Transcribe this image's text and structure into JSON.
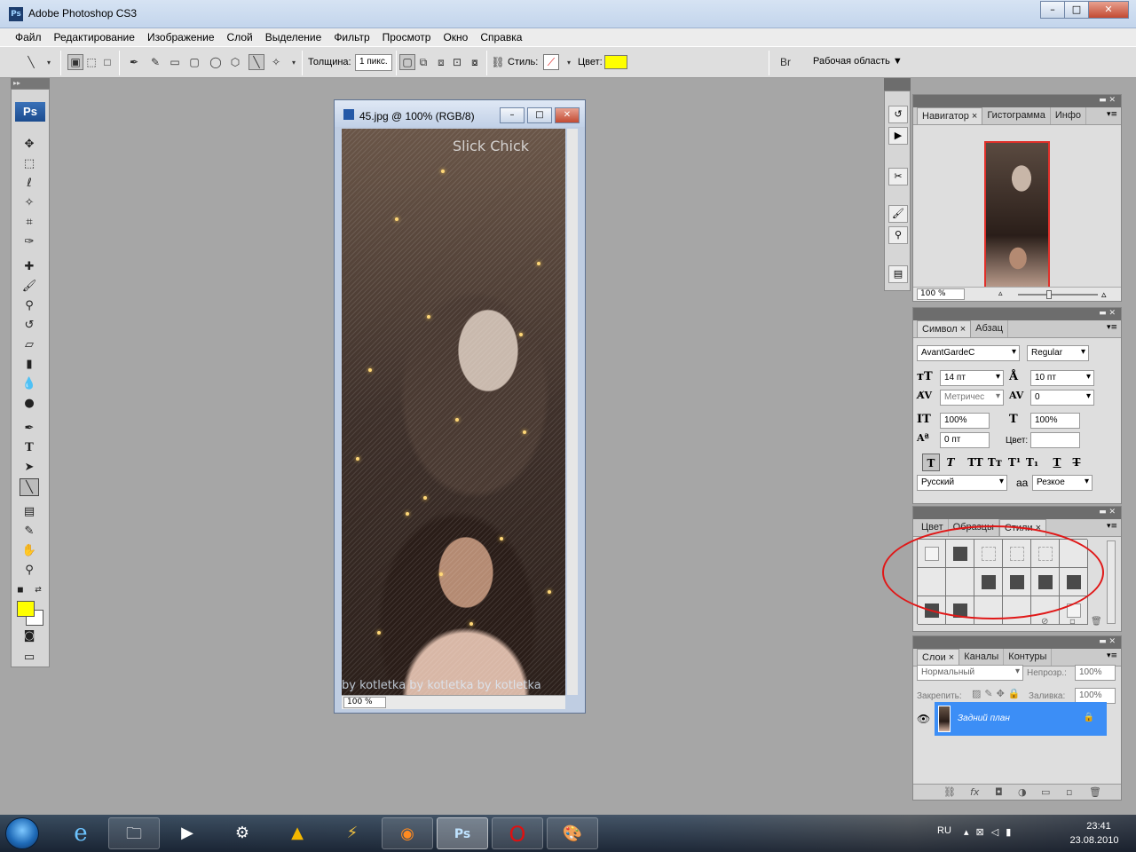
{
  "window": {
    "title": "Adobe Photoshop CS3",
    "app_icon": "Ps"
  },
  "menu": [
    "Файл",
    "Редактирование",
    "Изображение",
    "Слой",
    "Выделение",
    "Фильтр",
    "Просмотр",
    "Окно",
    "Справка"
  ],
  "options": {
    "weight_label": "Толщина:",
    "weight_value": "1 пикс.",
    "style_label": "Стиль:",
    "color_label": "Цвет:",
    "color_value": "#ffff00",
    "workspace_label": "Рабочая область"
  },
  "tools": {
    "logo": "Ps",
    "fg_color": "#ffff00",
    "bg_color": "#ffffff"
  },
  "document": {
    "title": "45.jpg @ 100% (RGB/8)",
    "zoom": "100 %",
    "watermark_top": "Slick Chick",
    "watermark_bottom": "by kotletka by kotletka by kotletka"
  },
  "navigator": {
    "tabs": [
      "Навигатор",
      "Гистограмма",
      "Инфо"
    ],
    "zoom": "100 %"
  },
  "character": {
    "tabs": [
      "Символ",
      "Абзац"
    ],
    "font_family": "AvantGardeC",
    "font_style": "Regular",
    "size": "14 пт",
    "leading": "10 пт",
    "kerning": "Метричес",
    "tracking": "0",
    "vscale": "100%",
    "hscale": "100%",
    "baseline": "0 пт",
    "color_label": "Цвет:",
    "language": "Русский",
    "antialias_prefix": "aa",
    "antialias": "Резкое"
  },
  "styles": {
    "tabs": [
      "Цвет",
      "Образцы",
      "Стили"
    ]
  },
  "layers": {
    "tabs": [
      "Слои",
      "Каналы",
      "Контуры"
    ],
    "blend_mode": "Нормальный",
    "opacity_label": "Непрозр.:",
    "opacity": "100%",
    "lock_label": "Закрепить:",
    "fill_label": "Заливка:",
    "fill": "100%",
    "layer_name": "Задний план"
  },
  "taskbar": {
    "lang": "RU",
    "time": "23:41",
    "date": "23.08.2010"
  },
  "colors": {
    "accent": "#3c8ef6",
    "highlight_circle": "#e01818"
  }
}
